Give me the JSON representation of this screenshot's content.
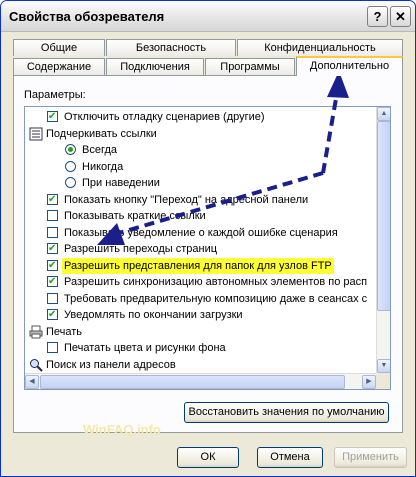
{
  "window": {
    "title": "Свойства обозревателя",
    "help_label": "?",
    "close_label": "✕"
  },
  "tabs": {
    "row1": [
      "Общие",
      "Безопасность",
      "Конфиденциальность"
    ],
    "row2": [
      "Содержание",
      "Подключения",
      "Программы",
      "Дополнительно"
    ],
    "active": "Дополнительно"
  },
  "panel": {
    "params_label": "Параметры:",
    "items": [
      {
        "type": "checkbox",
        "checked": true,
        "label": "Отключить отладку сценариев (другие)"
      },
      {
        "type": "group",
        "icon": "settings-icon",
        "label": "Подчеркивать ссылки"
      },
      {
        "type": "radio",
        "checked": true,
        "label": "Всегда"
      },
      {
        "type": "radio",
        "checked": false,
        "label": "Никогда"
      },
      {
        "type": "radio",
        "checked": false,
        "label": "При наведении"
      },
      {
        "type": "checkbox",
        "checked": true,
        "label": "Показать кнопку \"Переход\" на адресной панели"
      },
      {
        "type": "checkbox",
        "checked": false,
        "label": "Показывать краткие ссылки"
      },
      {
        "type": "checkbox",
        "checked": false,
        "label": "Показывать уведомление о каждой ошибке сценария"
      },
      {
        "type": "checkbox",
        "checked": true,
        "label": "Разрешить переходы страниц"
      },
      {
        "type": "checkbox",
        "checked": true,
        "highlighted": true,
        "label": "Разрешить представления для папок для узлов FTP"
      },
      {
        "type": "checkbox",
        "checked": true,
        "label": "Разрешить синхронизацию автономных элементов по расп"
      },
      {
        "type": "checkbox",
        "checked": false,
        "label": "Требовать предварительную композицию даже в сеансах с"
      },
      {
        "type": "checkbox",
        "checked": true,
        "label": "Уведомлять по окончании загрузки"
      },
      {
        "type": "group",
        "icon": "printer-icon",
        "label": "Печать"
      },
      {
        "type": "checkbox",
        "checked": false,
        "label": "Печатать цвета и рисунки фона"
      },
      {
        "type": "group",
        "icon": "search-icon",
        "label": "Поиск из панели адресов"
      }
    ],
    "restore_label": "Восстановить значения по умолчанию"
  },
  "buttons": {
    "ok": "ОК",
    "cancel": "Отмена",
    "apply": "Применить"
  },
  "watermark": "WinFAQ.info",
  "colors": {
    "arrow": "#1a1f8c",
    "highlight": "#ffff33",
    "tab_accent": "#ffc83c"
  }
}
